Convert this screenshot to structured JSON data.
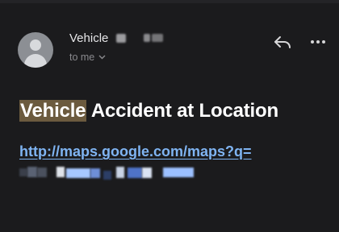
{
  "email": {
    "sender_name": "Vehicle",
    "recipient_label": "to me",
    "subject_highlight": "Vehicle",
    "subject_rest": " Accident at Location",
    "link_text": "http://maps.google.com/maps?q=",
    "link_continuation": "?,",
    "icons": {
      "avatar": "default-person-avatar",
      "reply": "reply-arrow-icon",
      "more": "more-options-icon",
      "expand": "chevron-down-icon"
    }
  },
  "colors": {
    "background": "#1b1b1d",
    "link": "#7fb4f2",
    "subject_highlight_bg": "#6b5a3e",
    "secondary_text": "#8a8a8e"
  }
}
